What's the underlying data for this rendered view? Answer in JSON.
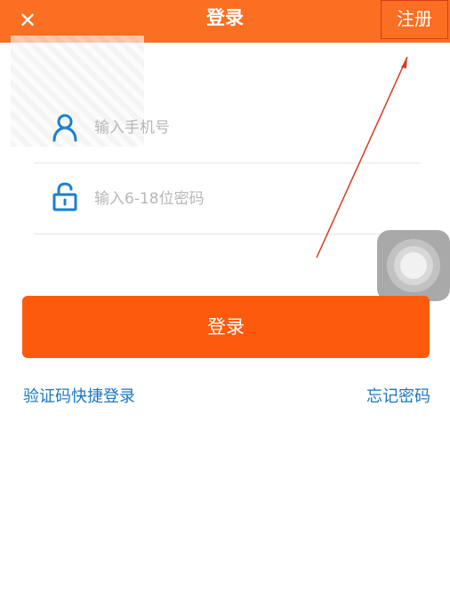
{
  "header": {
    "close_icon": "✕",
    "title": "登录",
    "register_label": "注册"
  },
  "form": {
    "phone_placeholder": "输入手机号",
    "password_placeholder": "输入6-18位密码",
    "login_label": "登录"
  },
  "links": {
    "sms_login": "验证码快捷登录",
    "forgot_password": "忘记密码"
  },
  "colors": {
    "header": "#fa6f22",
    "button": "#fd5a0e",
    "link": "#1a76c4",
    "icon": "#1a7fd0",
    "annotation": "#d63b1f"
  },
  "icons": {
    "close": "close-icon",
    "phone_field": "user-icon",
    "password_field": "lock-icon",
    "assistive": "assistive-touch-icon"
  }
}
